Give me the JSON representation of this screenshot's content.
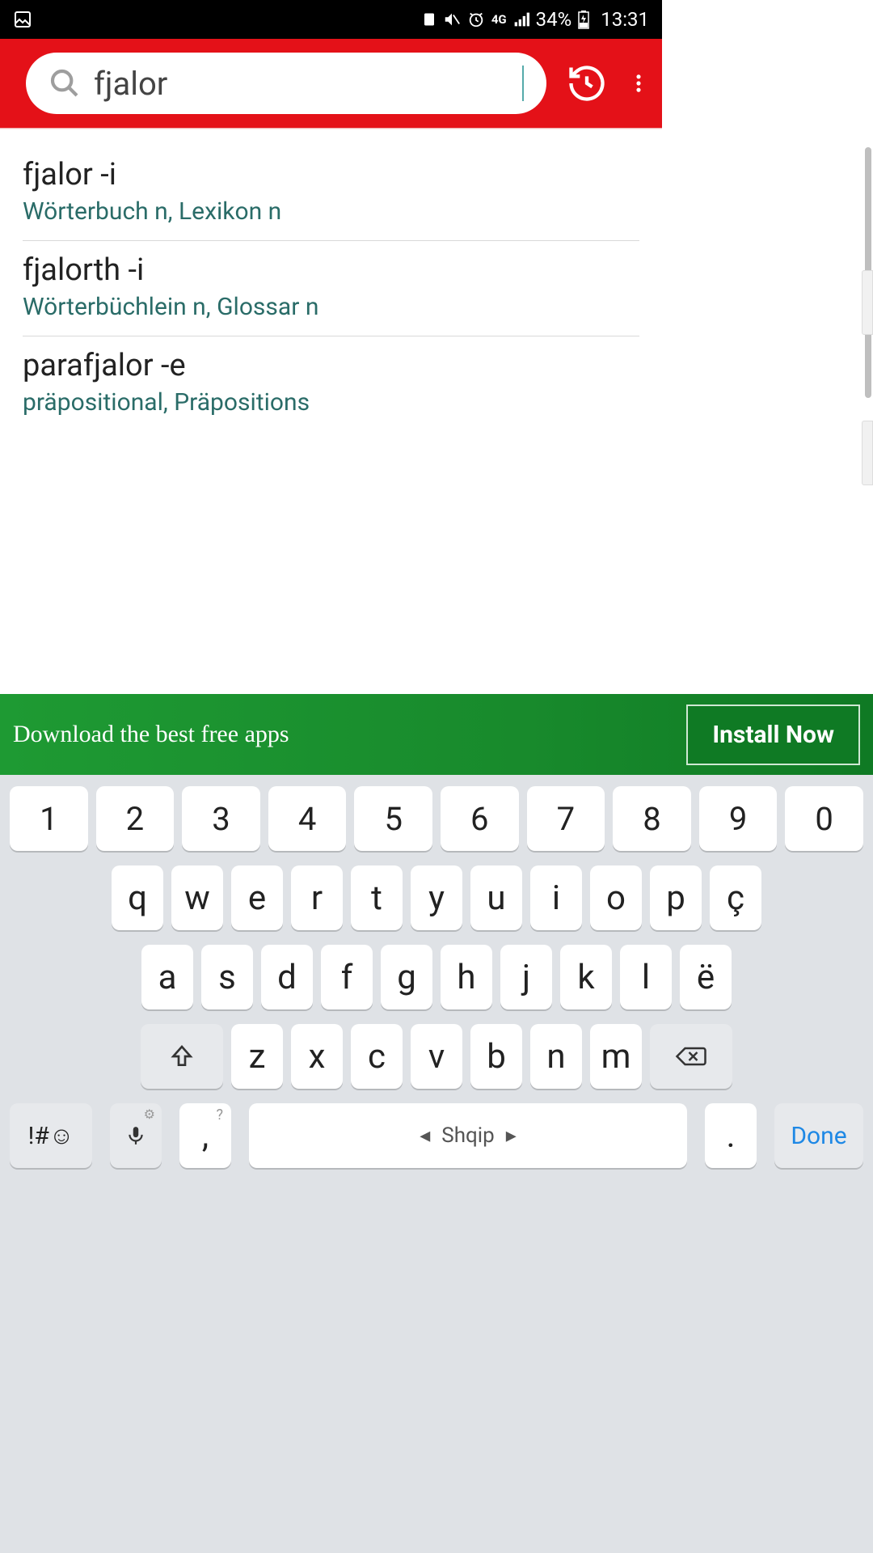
{
  "status": {
    "battery_pct": "34%",
    "time": "13:31",
    "net": "4G"
  },
  "search": {
    "value": "fjalor"
  },
  "results": [
    {
      "term": "fjalor -i",
      "def": "Wörterbuch n, Lexikon n"
    },
    {
      "term": "fjalorth -i",
      "def": "Wörterbüchlein n, Glossar n"
    },
    {
      "term": "parafjalor -e",
      "def": "präpositional, Präpositions"
    }
  ],
  "ad": {
    "text": "Download the best free apps",
    "cta": "Install Now"
  },
  "keyboard": {
    "row1": [
      "1",
      "2",
      "3",
      "4",
      "5",
      "6",
      "7",
      "8",
      "9",
      "0"
    ],
    "row2": [
      "q",
      "w",
      "e",
      "r",
      "t",
      "y",
      "u",
      "i",
      "o",
      "p",
      "ç"
    ],
    "row3": [
      "a",
      "s",
      "d",
      "f",
      "g",
      "h",
      "j",
      "k",
      "l",
      "ë"
    ],
    "row4": [
      "z",
      "x",
      "c",
      "v",
      "b",
      "n",
      "m"
    ],
    "sym": "!#☺",
    "comma": ",",
    "comma_hint": "?",
    "space_lang": "Shqip",
    "dot": ".",
    "done": "Done"
  }
}
